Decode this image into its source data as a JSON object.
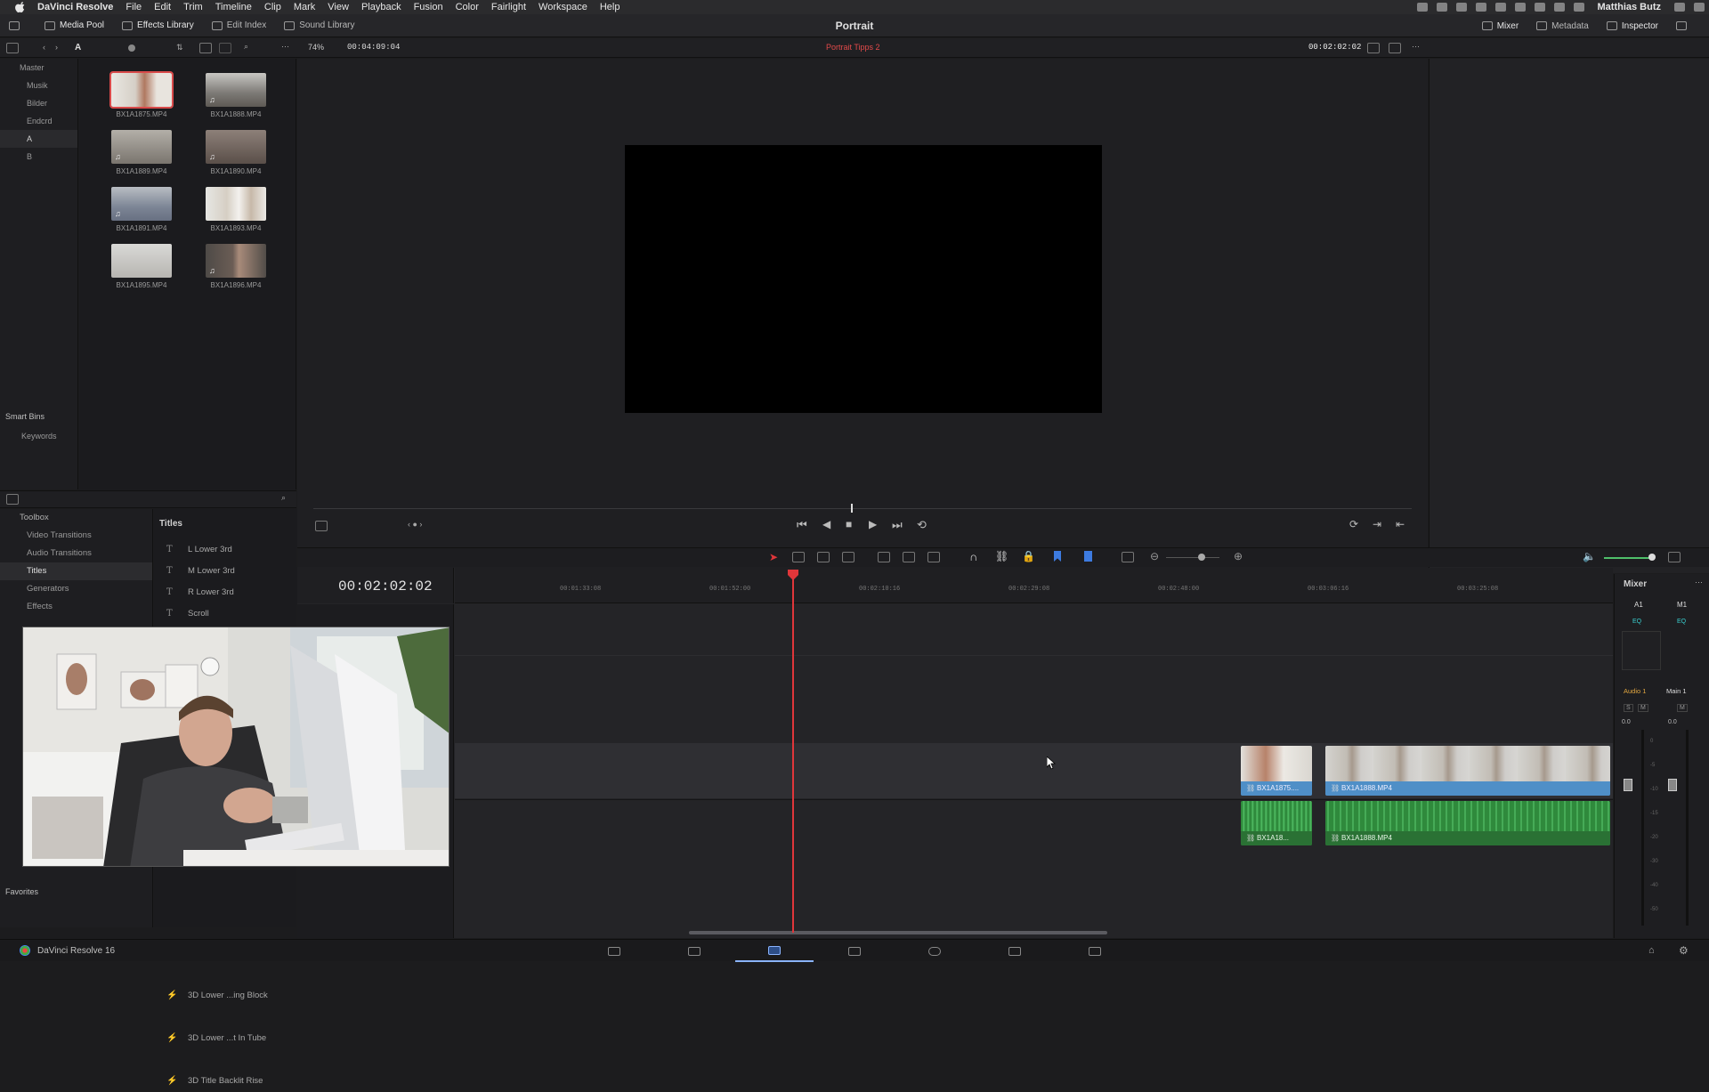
{
  "menubar": {
    "app": "DaVinci Resolve",
    "items": [
      "File",
      "Edit",
      "Trim",
      "Timeline",
      "Clip",
      "Mark",
      "View",
      "Playback",
      "Fusion",
      "Color",
      "Fairlight",
      "Workspace",
      "Help"
    ],
    "user": "Matthias Butz"
  },
  "topbar": {
    "media_pool": "Media Pool",
    "effects_library": "Effects Library",
    "edit_index": "Edit Index",
    "sound_library": "Sound Library",
    "title": "Portrait",
    "mixer": "Mixer",
    "metadata": "Metadata",
    "inspector": "Inspector"
  },
  "toolbar2": {
    "bin_label": "A",
    "zoom": "74%",
    "duration": "00:04:09:04",
    "timeline_name": "Portrait Tipps 2",
    "timecode": "00:02:02:02"
  },
  "bins": {
    "master": "Master",
    "items": [
      "Musik",
      "Bilder",
      "Endcrd",
      "A",
      "B"
    ],
    "selected": "A",
    "smart_bins": "Smart Bins",
    "keywords": "Keywords"
  },
  "clips": [
    {
      "name": "BX1A1875.MP4",
      "selected": true
    },
    {
      "name": "BX1A1888.MP4",
      "selected": false
    },
    {
      "name": "BX1A1889.MP4",
      "selected": false
    },
    {
      "name": "BX1A1890.MP4",
      "selected": false
    },
    {
      "name": "BX1A1891.MP4",
      "selected": false
    },
    {
      "name": "BX1A1893.MP4",
      "selected": false
    },
    {
      "name": "BX1A1895.MP4",
      "selected": false
    },
    {
      "name": "BX1A1896.MP4",
      "selected": false
    }
  ],
  "effects": {
    "toolbox": "Toolbox",
    "tree": [
      "Video Transitions",
      "Audio Transitions",
      "Titles",
      "Generators",
      "Effects"
    ],
    "selected": "Titles",
    "list_header": "Titles",
    "titles": [
      "L Lower 3rd",
      "M Lower 3rd",
      "R Lower 3rd",
      "Scroll"
    ],
    "fusion_titles": [
      "3D Lower ...ing Block",
      "3D Lower ...t In Tube",
      "3D Title Backlit Rise"
    ],
    "favorites": "Favorites"
  },
  "timeline": {
    "timecode": "00:02:02:02",
    "ruler": [
      "00:01:33:08",
      "00:01:52:00",
      "00:02:10:16",
      "00:02:29:08",
      "00:02:48:00",
      "00:03:06:16",
      "00:03:25:08"
    ],
    "video_clips": [
      "BX1A1875....",
      "BX1A1888.MP4"
    ],
    "audio_clips": [
      "BX1A18...",
      "BX1A1888.MP4"
    ]
  },
  "mixer": {
    "title": "Mixer",
    "channels": [
      "A1",
      "M1"
    ],
    "eq": "EQ",
    "track_a": "Audio 1",
    "track_m": "Main 1",
    "solo": "S",
    "mute": "M",
    "level_a": "0.0",
    "level_m": "0.0",
    "scale": [
      "0",
      "-5",
      "-10",
      "-15",
      "-20",
      "-30",
      "-40",
      "-50"
    ]
  },
  "bottombar": {
    "product": "DaVinci Resolve 16"
  },
  "colors": {
    "accent_red": "#e0363a",
    "video_clip": "#4f8fc7",
    "audio_clip": "#2f8a3c",
    "page_active": "#8ab4ff"
  }
}
